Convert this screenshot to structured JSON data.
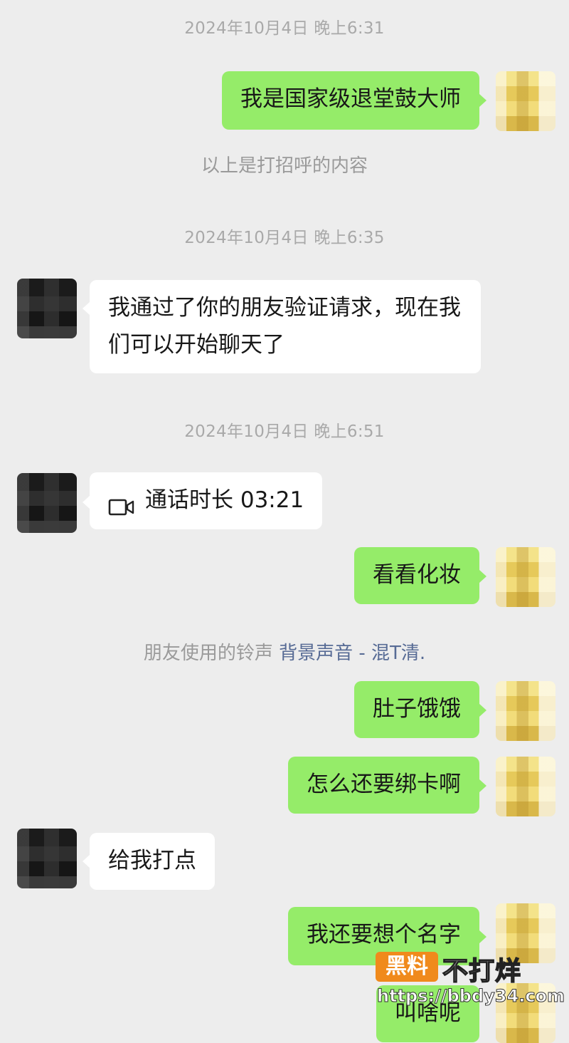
{
  "timestamps": [
    "2024年10月4日 晚上6:31",
    "2024年10月4日 晚上6:35",
    "2024年10月4日 晚上6:51"
  ],
  "messages": {
    "m1": "我是国家级退堂鼓大师",
    "m2": "我通过了你的朋友验证请求，现在我们可以开始聊天了",
    "m3": "看看化妆",
    "m4": "肚子饿饿",
    "m5": "怎么还要绑卡啊",
    "m6": "给我打点",
    "m7": "我还要想个名字",
    "m8": "叫啥呢"
  },
  "system": {
    "greeting_note": "以上是打招呼的内容",
    "ringtone_prefix": "朋友使用的铃声",
    "ringtone_link": "背景声音 - 混T清."
  },
  "call": {
    "label": "通话时长 03:21",
    "icon": "video-call-icon"
  },
  "watermark": {
    "badge": "黑料",
    "title": "不打烊",
    "url": "https://bbdy34.com"
  },
  "colors": {
    "background": "#ededed",
    "outgoing_bubble": "#95ec69",
    "incoming_bubble": "#ffffff",
    "link": "#576b95",
    "timestamp": "#a9a9a9"
  }
}
